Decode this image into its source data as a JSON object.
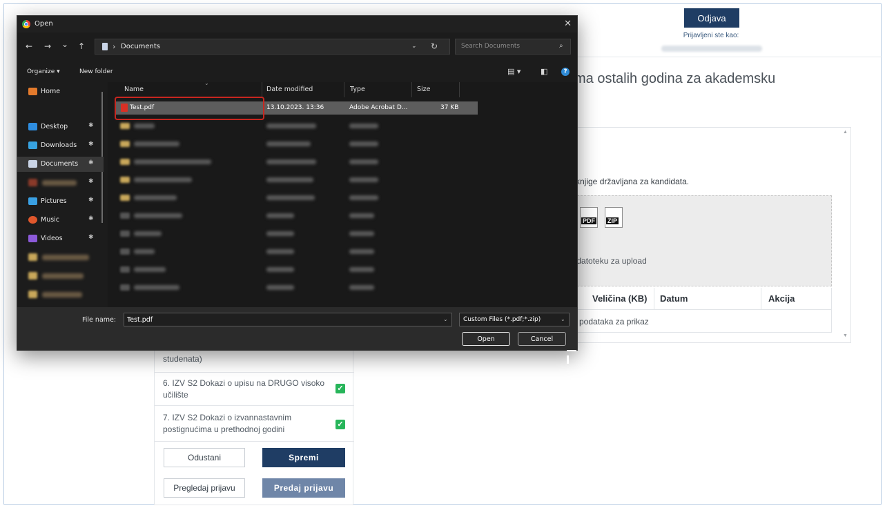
{
  "page": {
    "logout_label": "Odjava",
    "logged_as": "Prijavljeni ste kao:",
    "heading_fragment": "tima ostalih godina za akademsku",
    "instruction_fragment": "iz knjige državljana za kandidata.",
    "file_types": [
      "PDF",
      "ZIP"
    ],
    "drop_text_fragment": "te datoteku za upload",
    "table": {
      "columns": [
        "Veličina (KB)",
        "Datum",
        "Akcija"
      ],
      "empty_fragment": "a podataka za prikaz"
    },
    "documents": [
      {
        "label": "studenata)",
        "checked": false
      },
      {
        "label": "6. IZV S2 Dokazi o upisu na DRUGO visoko učilište",
        "checked": true
      },
      {
        "label": "7. IZV S2 Dokazi o izvannastavnim postignućima u prethodnoj godini",
        "checked": true
      }
    ],
    "buttons": {
      "cancel": "Odustani",
      "save": "Spremi",
      "preview": "Pregledaj prijavu",
      "submit": "Predaj prijavu"
    },
    "colors": {
      "primary": "#1f3d64",
      "primary_disabled": "#6f86a8",
      "check": "#27b55a"
    }
  },
  "dialog": {
    "title": "Open",
    "close_icon": "close-icon",
    "nav": {
      "back": "←",
      "forward": "→",
      "recent": "⌄",
      "up": "↑"
    },
    "address": {
      "separator": "›",
      "folder": "Documents"
    },
    "search_placeholder": "Search Documents",
    "toolbar": {
      "organize": "Organize ▾",
      "new_folder": "New folder"
    },
    "nav_pane": [
      {
        "label": "Home",
        "icon": "home-icon",
        "pinned": false,
        "color": "#e37a2c"
      },
      {
        "label": "Desktop",
        "icon": "desktop-icon",
        "pinned": true,
        "color": "#2e8de0"
      },
      {
        "label": "Downloads",
        "icon": "downloads-icon",
        "pinned": true,
        "color": "#37a2e0"
      },
      {
        "label": "Documents",
        "icon": "documents-icon",
        "pinned": true,
        "color": "#c9d4e6",
        "selected": true
      },
      {
        "label": "",
        "icon": "folder-icon",
        "pinned": true,
        "color": "#8a3a2a"
      },
      {
        "label": "Pictures",
        "icon": "pictures-icon",
        "pinned": true,
        "color": "#3aa0e3"
      },
      {
        "label": "Music",
        "icon": "music-icon",
        "pinned": true,
        "color": "#e0572c"
      },
      {
        "label": "Videos",
        "icon": "videos-icon",
        "pinned": true,
        "color": "#8c5ad9"
      },
      {
        "label": "",
        "icon": "folder-icon",
        "pinned": false,
        "color": "#c9a85a"
      },
      {
        "label": "",
        "icon": "folder-icon",
        "pinned": false,
        "color": "#c9a85a"
      },
      {
        "label": "",
        "icon": "folder-icon",
        "pinned": false,
        "color": "#c9a85a"
      }
    ],
    "columns": [
      "Name",
      "Date modified",
      "Type",
      "Size"
    ],
    "files": [
      {
        "name": "Test.pdf",
        "date": "13.10.2023. 13:36",
        "type": "Adobe Acrobat D...",
        "size": "37 KB",
        "selected": true
      }
    ],
    "file_name_label": "File name:",
    "file_name_value": "Test.pdf",
    "filter_value": "Custom Files (*.pdf;*.zip)",
    "open_label": "Open",
    "cancel_label": "Cancel"
  }
}
